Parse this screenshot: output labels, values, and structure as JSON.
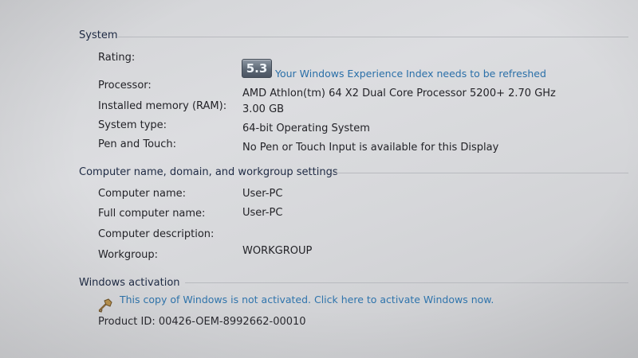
{
  "system": {
    "header": "System",
    "rating_label": "Rating:",
    "rating_score": "5.3",
    "rating_link": "Your Windows Experience Index needs to be refreshed",
    "processor_label": "Processor:",
    "processor_value": "AMD Athlon(tm) 64 X2 Dual Core Processor 5200+   2.70 GHz",
    "memory_label": "Installed memory (RAM):",
    "memory_value": "3.00 GB",
    "type_label": "System type:",
    "type_value": "64-bit Operating System",
    "pen_label": "Pen and Touch:",
    "pen_value": "No Pen or Touch Input is available for this Display"
  },
  "computer": {
    "header": "Computer name, domain, and workgroup settings",
    "name_label": "Computer name:",
    "name_value": "User-PC",
    "full_name_label": "Full computer name:",
    "full_name_value": "User-PC",
    "description_label": "Computer description:",
    "description_value": "",
    "workgroup_label": "Workgroup:",
    "workgroup_value": "WORKGROUP"
  },
  "activation": {
    "header": "Windows activation",
    "link_text": "This copy of Windows is not activated. Click here to activate Windows now.",
    "product_id_label": "Product ID: ",
    "product_id_value": "00426-OEM-8992662-00010",
    "icon": "activation-shield-icon"
  },
  "colors": {
    "link": "#2a6fa8",
    "header": "#1e2a44",
    "text": "#232328"
  }
}
